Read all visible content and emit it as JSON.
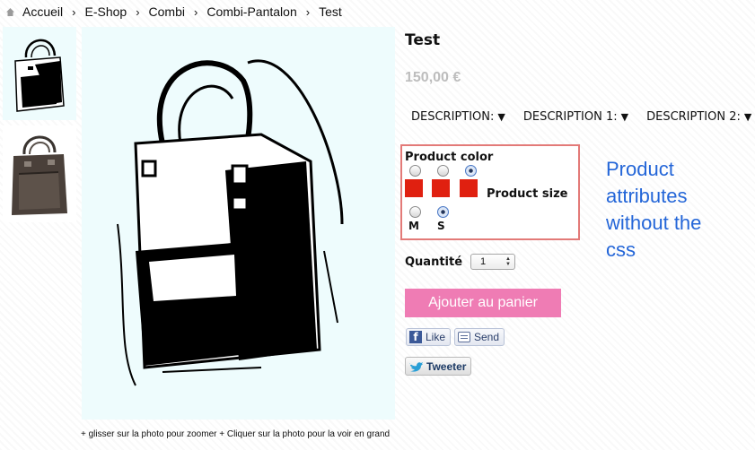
{
  "breadcrumb": {
    "home_icon": "home-icon",
    "items": [
      "Accueil",
      "E-Shop",
      "Combi",
      "Combi-Pantalon",
      "Test"
    ],
    "separator": "›"
  },
  "gallery": {
    "caption": "+ glisser sur la photo pour zoomer + Cliquer sur la photo pour la voir en grand"
  },
  "product": {
    "title": "Test",
    "price": "150,00 €",
    "descriptions": [
      "DESCRIPTION:",
      "DESCRIPTION 1:",
      "DESCRIPTION 2:"
    ],
    "attributes": {
      "color_label": "Product color",
      "color_selected_index": 2,
      "swatch_color": "#e02010",
      "size_label": "Product size",
      "sizes": [
        "M",
        "S"
      ],
      "size_selected_index": 1
    },
    "quantity": {
      "label": "Quantité",
      "value": "1"
    },
    "add_to_cart": "Ajouter au panier"
  },
  "annotation": {
    "text": "Product attributes without the css",
    "color": "#2466d8"
  },
  "social": {
    "like": "Like",
    "send": "Send",
    "tweet": "Tweeter"
  },
  "colors": {
    "accent_pink": "#ef7cb4",
    "highlight_border": "#e37a78",
    "price_gray": "#bdbdbd"
  }
}
